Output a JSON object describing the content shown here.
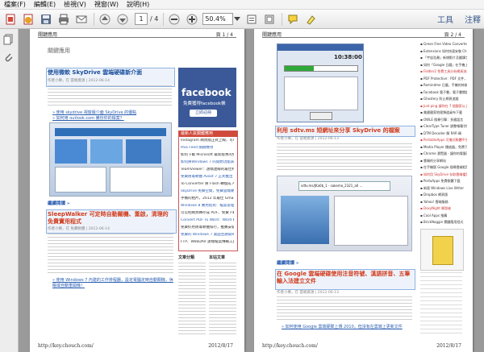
{
  "menu": [
    "檔案(F)",
    "編輯(E)",
    "檢視(V)",
    "視窗(W)",
    "說明(H)"
  ],
  "toolbar": {
    "current_page": "1",
    "page_count": "/ 4",
    "zoom": "50.4%",
    "right_links": [
      "工具",
      "注釋"
    ]
  },
  "page1": {
    "header_left": "關鍵應用",
    "header_right": "頁 1 / 4",
    "blog_title": "關鍵應用",
    "post1_title": "使用微軟 SkyDrive 雲端硬碟新介面",
    "post1_meta": "作者小樂，在 雲端資源 | 2012-06-14",
    "post1_link1": "» 使用 skydrive 視窗版介面 SkyDrive 的優點",
    "post1_link2": "» 如何用 outlook.com 備份你的檔案？",
    "read_more": "繼續閱讀 »",
    "post2_title": "SleepWalker 可定時自動關機、重啟，清理的免費實用程式",
    "post2_meta": "作者小樂，在 免費軟體 | 2012-06-14",
    "post2_link": "» 使用 Windows 7 內建的工作排程器，設定電腦定時自動關機，休眠或自動重開機！",
    "facebook_title": "facebook",
    "facebook_sub": "免費獲得facebook帳",
    "facebook_button": "立即註冊",
    "sidebar_title": "最新人氣關鍵應用",
    "sidebar_items": [
      "Instagram 網頁版正式上線，可以在電腦上看、評論照片",
      "RSS Feed 關鍵應用",
      "如何下載 Microsoft 最新版本的免費軟體",
      "如何將Windows 7 的開始功能表，設定與Windows 8 相同的介面",
      "TeamViewer：遠端連線的最佳利器，免費軟體",
      "免費防毒軟體 Avast 7 正式推出",
      "To Converter 將 Flash 轉換成 AVI、MPG、GIF、MP4 等格式",
      "SkyDrive 免費空間，免費雲端硬碟可以擴充到 25GB",
      "手機的相片，2012 年最佳 Gmail 郵件信箱",
      "Windows 8 應用程式：檔案管理工具",
      "可以把網頁轉存成 PDF、免費下載",
      "Convert PDF To Word：Word 轉 PDF 與 PDF 轉 Word 線上轉換",
      "免費好用防毒軟體排行，推薦安裝",
      "免費的 Windows 7 桌面主題與佈景主題",
      "FTP、WebDAV 遠端檔案傳輸工具"
    ],
    "sidebar_col1": "文章分類",
    "sidebar_col2": "本站文章",
    "footer_url": "http://key.chouch.com/",
    "footer_date": "2012/8/17"
  },
  "page2": {
    "header_left": "關鍵應用",
    "header_right": "頁 2 / 4",
    "app_time": "10:38:00",
    "post3_title": "利用 sdtv.ms 短網址來分享 SkyDrive 的檔案",
    "post3_meta": "作者小樂，在 雲端資源 | 2012-06-13",
    "dialog_text": "sdtv.ms/JKa0b_1 - sakemo_2321_a0 ...",
    "post4_title": "在 Google 雲端硬碟使用注音符號、漢語拼音、五筆輸入法建立文件",
    "post4_meta": "作者小樂，在 雲端資源 | 2012-06-13",
    "post4_link": "» 如何使用 Google 雲端硬碟上傳 2010，但沒有在雲端上更新文件",
    "read_more": "繼續閱讀 »",
    "bullets": [
      "Green Free Video Converter 影片轉檔軟體",
      "Extensions 如何快速安裝 Chrome 擴充功能",
      "「宇宙浩瀚」新增影片及翻譯字幕",
      "如何「Google 日曆」在手機上同步",
      "Fiddler2 免費工具分析網頁流量",
      "PDF Protective：PDF 文件，讓人無法複製",
      "Remindme 日曆，手機的待辦事項",
      "Facebook 電子書，電子書閱讀器",
      "Ghostery 防止網頁追蹤",
      "Just.ping 讓你在 7 個國家以上測試網站",
      "美國國家地理頻道桌布下載",
      "OWLE 搜尋引擎：多國語言",
      "ClearType Tuner 調整螢幕字體",
      "DTM Decoder 解 RAR 碼",
      "PortableApps 可攜式軟體平台",
      "Media Player 播放器，免費下載",
      "Chrome 瀏覽器 - 讓你的電腦可以打開",
      "雲端的分享網站",
      "在手機版 Google 搜尋雲端相簿",
      "如何用 SkyDrive 存取雲端檔案",
      "PortaApps 免費軟體下載",
      "新版 Windows Live Writer",
      "Dropbox 網頁版",
      "Yahoo! 雲端服務",
      "DoxyNight 開發者",
      "Cool Apps 推薦",
      "BrickNaggin 關鍵應用程式"
    ],
    "footer_url": "http://key.chouch.com/",
    "footer_date": "2012/8/17"
  },
  "colors": {
    "accent_blue": "#1a4f9c",
    "accent_red": "#d13b1c",
    "facebook_blue": "#3b5998"
  }
}
